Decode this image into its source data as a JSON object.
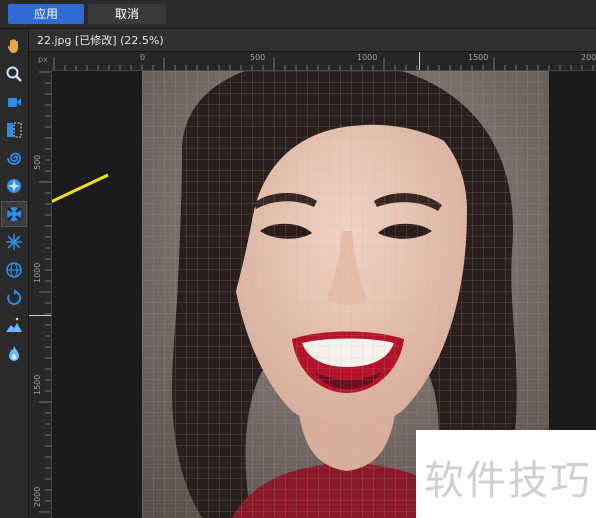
{
  "actions": {
    "apply": "应用",
    "cancel": "取消"
  },
  "document": {
    "title": "22.jpg [已修改] (22.5%)"
  },
  "ruler": {
    "unit": "px",
    "horizontal_labels": [
      "0",
      "500",
      "1000",
      "1500",
      "200"
    ],
    "vertical_labels": [
      "500",
      "1000",
      "1500",
      "2000"
    ]
  },
  "tools": [
    "hand-icon",
    "zoom-icon",
    "push-forward-icon",
    "push-left-icon",
    "twirl-icon",
    "pinch-icon",
    "punch-icon",
    "turbulence-icon",
    "sphere-icon",
    "rotate-icon",
    "freeze-icon",
    "thaw-icon"
  ],
  "active_tool": "punch-icon",
  "colors": {
    "accent": "#2f6bd3",
    "arrow": "#f2e21a"
  },
  "watermark": "软件技巧"
}
